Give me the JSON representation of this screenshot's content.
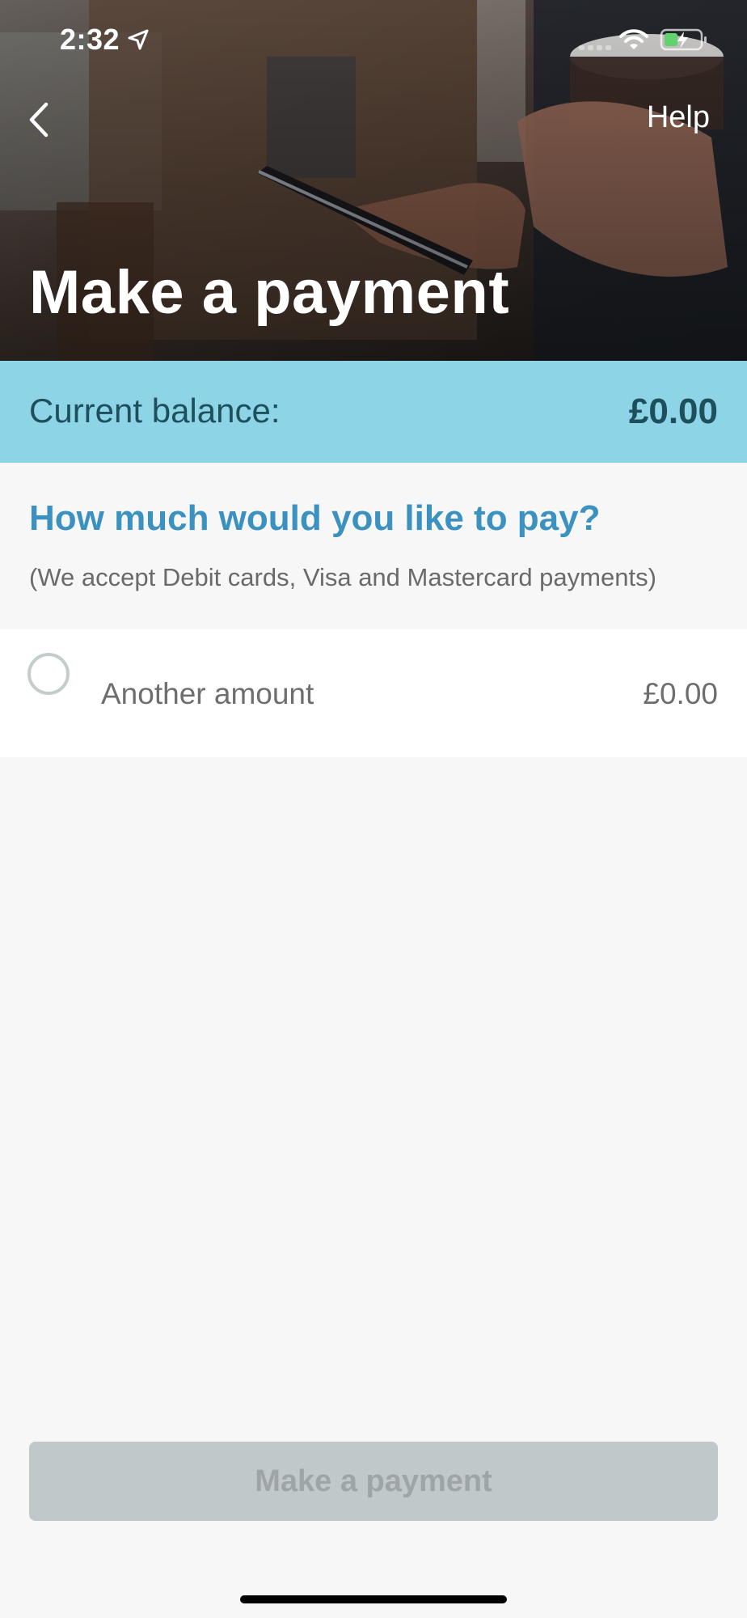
{
  "status_bar": {
    "time": "2:32"
  },
  "header": {
    "title": "Make a payment",
    "help_label": "Help",
    "icons": {
      "back": "chevron-left-icon",
      "location": "location-arrow-icon",
      "wifi": "wifi-icon",
      "battery": "battery-charging-icon"
    }
  },
  "balance": {
    "label": "Current balance:",
    "value": "£0.00"
  },
  "question": {
    "title": "How much would you like to pay?",
    "subtitle": "(We accept Debit cards, Visa and Mastercard payments)"
  },
  "options": [
    {
      "label": "Another amount",
      "amount": "£0.00",
      "selected": false
    }
  ],
  "action": {
    "button_label": "Make a payment",
    "enabled": false
  },
  "colors": {
    "balance_bar": "#8cd4e6",
    "balance_text": "#1d4f5c",
    "accent": "#3b91c0",
    "button_disabled_bg": "#c1c8c9",
    "button_disabled_text": "#9ea5a6",
    "background": "#f7f7f7"
  }
}
